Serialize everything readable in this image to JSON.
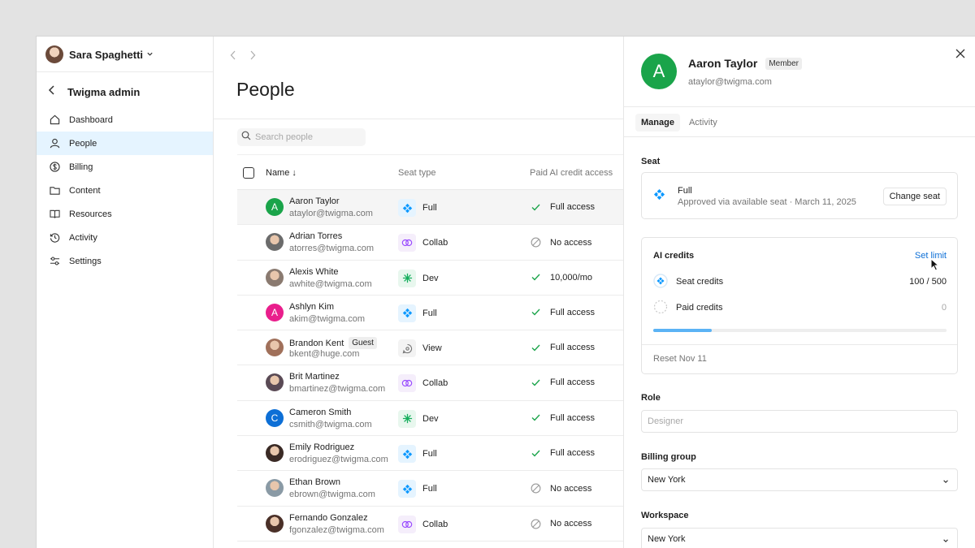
{
  "sidebar": {
    "user_name": "Sara Spaghetti",
    "admin_title": "Twigma admin",
    "items": [
      {
        "label": "Dashboard",
        "icon": "home-icon"
      },
      {
        "label": "People",
        "icon": "person-icon",
        "active": true
      },
      {
        "label": "Billing",
        "icon": "dollar-circle-icon"
      },
      {
        "label": "Content",
        "icon": "folder-icon"
      },
      {
        "label": "Resources",
        "icon": "book-icon"
      },
      {
        "label": "Activity",
        "icon": "history-icon"
      },
      {
        "label": "Settings",
        "icon": "sliders-icon"
      }
    ]
  },
  "main": {
    "title": "People",
    "search_placeholder": "Search people",
    "columns": {
      "name": "Name ↓",
      "seat": "Seat type",
      "access": "Paid AI credit access"
    },
    "rows": [
      {
        "name": "Aaron Taylor",
        "email": "ataylor@twigma.com",
        "avatar_letter": "A",
        "avatar_color": "#1aa44a",
        "seat": "Full",
        "access": "Full access",
        "access_icon": "check-icon"
      },
      {
        "name": "Adrian Torres",
        "email": "atorres@twigma.com",
        "avatar_letter": "",
        "avatar_color": "#6b6b6b",
        "seat": "Collab",
        "access": "No access",
        "access_icon": "no-access-icon"
      },
      {
        "name": "Alexis White",
        "email": "awhite@twigma.com",
        "avatar_letter": "",
        "avatar_color": "#8a7a70",
        "seat": "Dev",
        "access": "10,000/mo",
        "access_icon": "check-icon"
      },
      {
        "name": "Ashlyn Kim",
        "email": "akim@twigma.com",
        "avatar_letter": "A",
        "avatar_color": "#e91e8c",
        "seat": "Full",
        "access": "Full access",
        "access_icon": "check-icon"
      },
      {
        "name": "Brandon Kent",
        "email": "bkent@huge.com",
        "avatar_letter": "",
        "avatar_color": "#a0705a",
        "badge": "Guest",
        "seat": "View",
        "access": "Full access",
        "access_icon": "check-icon"
      },
      {
        "name": "Brit Martinez",
        "email": "bmartinez@twigma.com",
        "avatar_letter": "",
        "avatar_color": "#5a4a55",
        "seat": "Collab",
        "access": "Full access",
        "access_icon": "check-icon"
      },
      {
        "name": "Cameron Smith",
        "email": "csmith@twigma.com",
        "avatar_letter": "C",
        "avatar_color": "#0d6fd6",
        "seat": "Dev",
        "access": "Full access",
        "access_icon": "check-icon"
      },
      {
        "name": "Emily Rodriguez",
        "email": "erodriguez@twigma.com",
        "avatar_letter": "",
        "avatar_color": "#3a2a25",
        "seat": "Full",
        "access": "Full access",
        "access_icon": "check-icon"
      },
      {
        "name": "Ethan Brown",
        "email": "ebrown@twigma.com",
        "avatar_letter": "",
        "avatar_color": "#8a9aa5",
        "seat": "Full",
        "access": "No access",
        "access_icon": "no-access-icon"
      },
      {
        "name": "Fernando Gonzalez",
        "email": "fgonzalez@twigma.com",
        "avatar_letter": "",
        "avatar_color": "#4a3028",
        "seat": "Collab",
        "access": "No access",
        "access_icon": "no-access-icon"
      }
    ]
  },
  "panel": {
    "avatar_letter": "A",
    "name": "Aaron Taylor",
    "badge": "Member",
    "email": "ataylor@twigma.com",
    "tabs": [
      "Manage",
      "Activity"
    ],
    "seat_label": "Seat",
    "seat_type": "Full",
    "seat_detail": "Approved via available seat · March 11, 2025",
    "change_seat": "Change seat",
    "ai_credits_label": "AI credits",
    "set_limit": "Set limit",
    "seat_credits_label": "Seat credits",
    "seat_credits_value": "100 / 500",
    "seat_credits_fraction": 0.2,
    "paid_credits_label": "Paid credits",
    "paid_credits_value": "0",
    "reset": "Reset Nov 11",
    "role_label": "Role",
    "role_placeholder": "Designer",
    "billing_label": "Billing group",
    "billing_value": "New York",
    "workspace_label": "Workspace",
    "workspace_value": "New York"
  },
  "colors": {
    "accent": "#0d6fd6",
    "active_nav": "#e5f4ff",
    "success": "#1aa44a",
    "progress": "#5bb3f5"
  }
}
